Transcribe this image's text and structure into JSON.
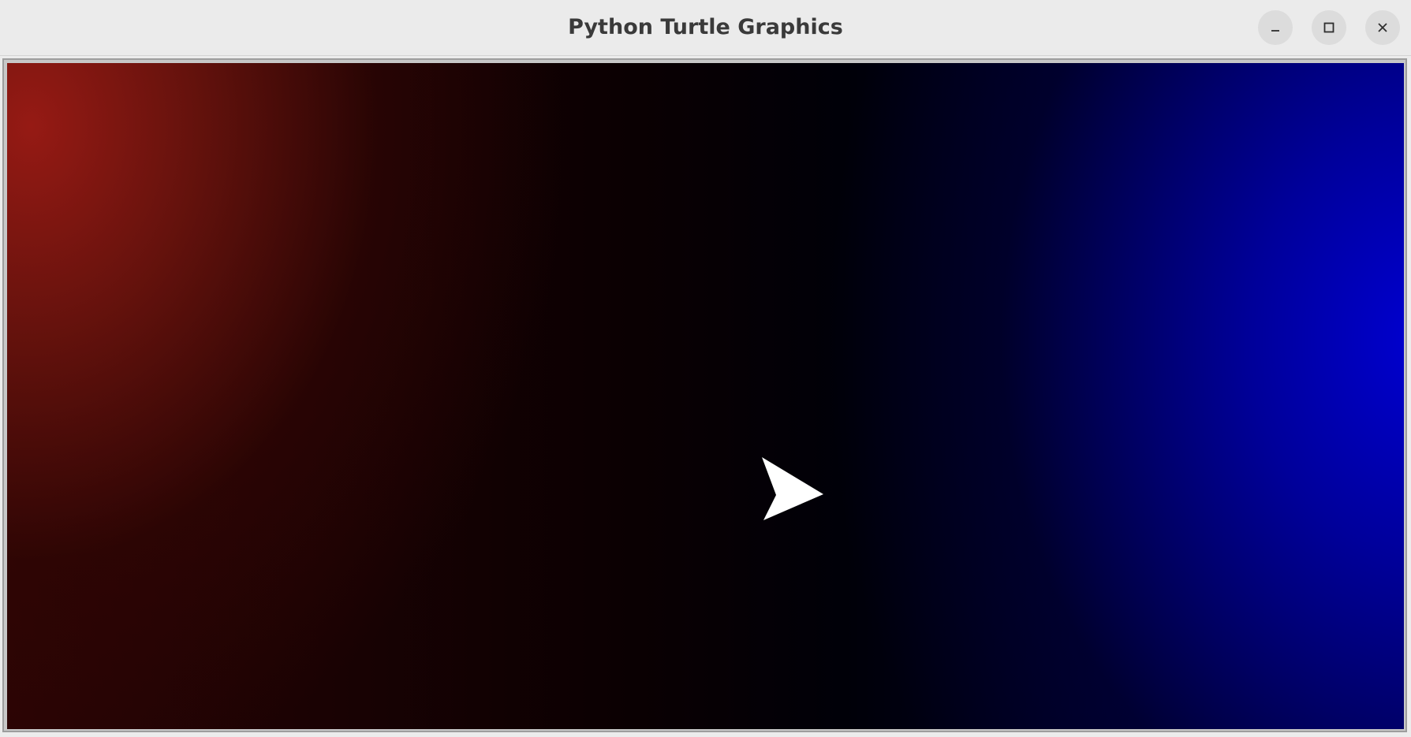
{
  "window": {
    "title": "Python Turtle Graphics",
    "controls": {
      "minimize_icon": "minimize-icon",
      "maximize_icon": "maximize-icon",
      "close_icon": "close-icon"
    }
  },
  "canvas": {
    "background": {
      "left_color": "#961a14",
      "center_color": "#000000",
      "right_color": "#0000d2"
    },
    "turtle": {
      "shape": "arrow",
      "color": "#ffffff",
      "heading_degrees": 0
    }
  }
}
